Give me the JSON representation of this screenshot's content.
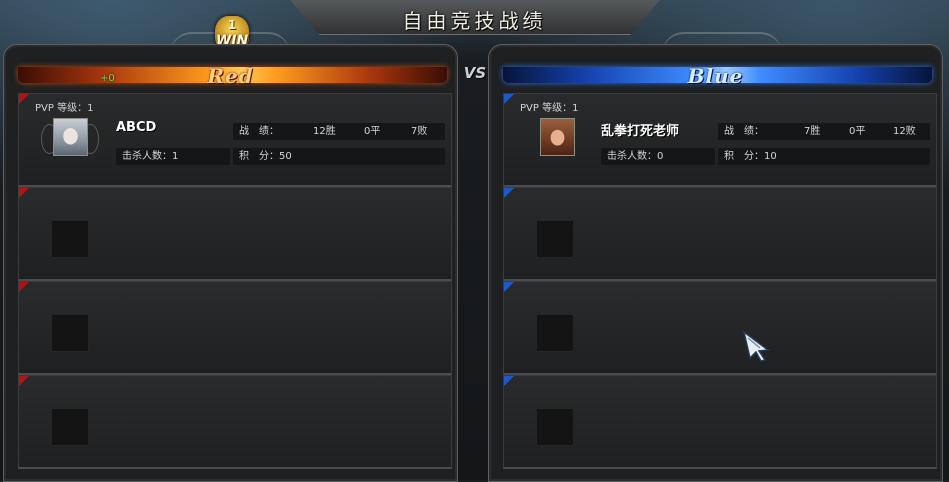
{
  "window": {
    "title": "自由竞技战绩"
  },
  "win_badge": {
    "count": "1",
    "label": "WIN"
  },
  "vs_label": "VS",
  "teams": {
    "red": {
      "name": "Red",
      "score_delta": "+0",
      "color": "#ff9c1e",
      "player": {
        "pvp_label": "PVP 等级：1",
        "name": "ABCD",
        "record_label": "战　绩：",
        "wins": "12胜",
        "draws": "0平",
        "losses": "7败",
        "kills_label": "击杀人数：1",
        "points_label": "积　分：50"
      }
    },
    "blue": {
      "name": "Blue",
      "color": "#3f8cff",
      "player": {
        "pvp_label": "PVP 等级：1",
        "name": "乱拳打死老师",
        "record_label": "战　绩：",
        "wins": "7胜",
        "draws": "0平",
        "losses": "12败",
        "kills_label": "击杀人数：0",
        "points_label": "积　分：10"
      }
    }
  }
}
